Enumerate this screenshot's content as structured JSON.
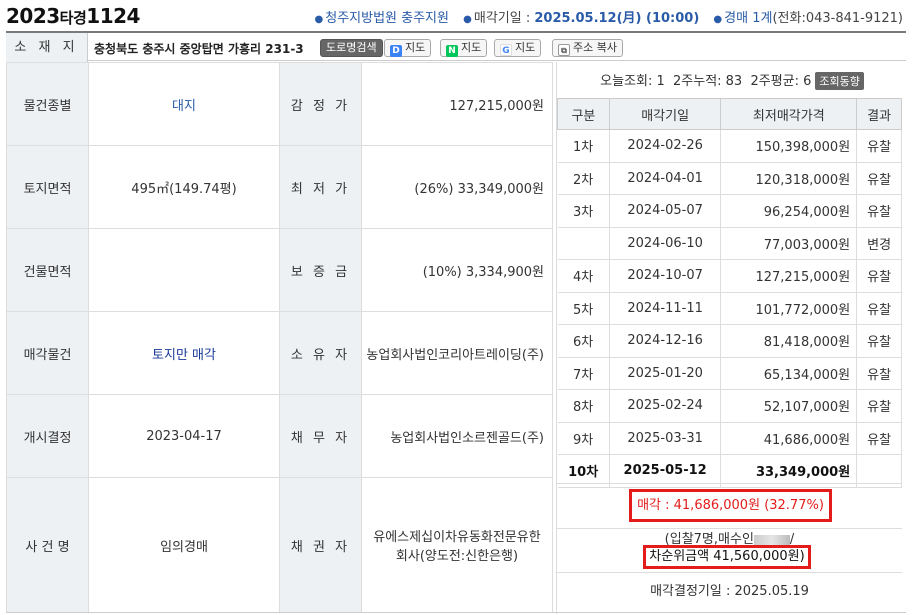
{
  "header": {
    "case_year": "2023",
    "case_kind": "타경",
    "case_num": "1124",
    "court": "청주지방법원 충주지원",
    "auction_date_label": "매각기일 : ",
    "auction_date": "2025.05.12(月) (10:00)",
    "dept": "경매 1계",
    "phone": "(전화:043-841-9121)"
  },
  "address": {
    "label": "소 재 지",
    "text": "충청북도 충주시 중앙탑면 가흥리 231-3",
    "road_btn": "도로명검색",
    "daum_btn": "지도",
    "naver_btn": "지도",
    "google_btn": "지도",
    "copy_btn": "주소 복사"
  },
  "details": [
    {
      "label": "물건종별",
      "value": "대지",
      "label2": "감 정 가",
      "value2": "127,215,000원"
    },
    {
      "label": "토지면적",
      "value": "495㎡(149.74평)",
      "label2": "최 저 가",
      "value2": "(26%) 33,349,000원"
    },
    {
      "label": "건물면적",
      "value": "",
      "label2": "보 증 금",
      "value2": "(10%) 3,334,900원"
    },
    {
      "label": "매각물건",
      "value": "토지만 매각",
      "label2": "소 유 자",
      "value2": "농업회사법인코리아트레이딩(주)"
    },
    {
      "label": "개시결정",
      "value": "2023-04-17",
      "label2": "채 무 자",
      "value2": "농업회사법인소르젠골드(주)"
    },
    {
      "label": "사 건 명",
      "value": "임의경매",
      "label2": "채 권 자",
      "value2": "유에스제십이차유동화전문유한회사(양도전:신한은행)"
    }
  ],
  "stats": {
    "text": "오늘조회: 1  2주누적: 83  2주평균: 6",
    "trend_btn": "조회동향"
  },
  "rounds_headers": [
    "구분",
    "매각기일",
    "최저매각가격",
    "결과"
  ],
  "rounds": [
    {
      "round": "1차",
      "date": "2024-02-26",
      "price": "150,398,000원",
      "result": "유찰"
    },
    {
      "round": "2차",
      "date": "2024-04-01",
      "price": "120,318,000원",
      "result": "유찰"
    },
    {
      "round": "3차",
      "date": "2024-05-07",
      "price": "96,254,000원",
      "result": "유찰"
    },
    {
      "round": "",
      "date": "2024-06-10",
      "price": "77,003,000원",
      "result": "변경"
    },
    {
      "round": "4차",
      "date": "2024-10-07",
      "price": "127,215,000원",
      "result": "유찰"
    },
    {
      "round": "5차",
      "date": "2024-11-11",
      "price": "101,772,000원",
      "result": "유찰"
    },
    {
      "round": "6차",
      "date": "2024-12-16",
      "price": "81,418,000원",
      "result": "유찰"
    },
    {
      "round": "7차",
      "date": "2025-01-20",
      "price": "65,134,000원",
      "result": "유찰"
    },
    {
      "round": "8차",
      "date": "2025-02-24",
      "price": "52,107,000원",
      "result": "유찰"
    },
    {
      "round": "9차",
      "date": "2025-03-31",
      "price": "41,686,000원",
      "result": "유찰"
    },
    {
      "round": "10차",
      "date": "2025-05-12",
      "price": "33,349,000원",
      "result": ""
    }
  ],
  "sale": {
    "label": "매각 : 41,686,000원",
    "pct": "(32.77%)"
  },
  "bid": {
    "prefix": "(입찰7명,매수인",
    "suffix": "/"
  },
  "second": "차순위금액 41,560,000원)",
  "decision": "매각결정기일 : 2025.05.19",
  "colors": {
    "accent": "#2a5ba8",
    "highlight": "#e31b1b"
  }
}
